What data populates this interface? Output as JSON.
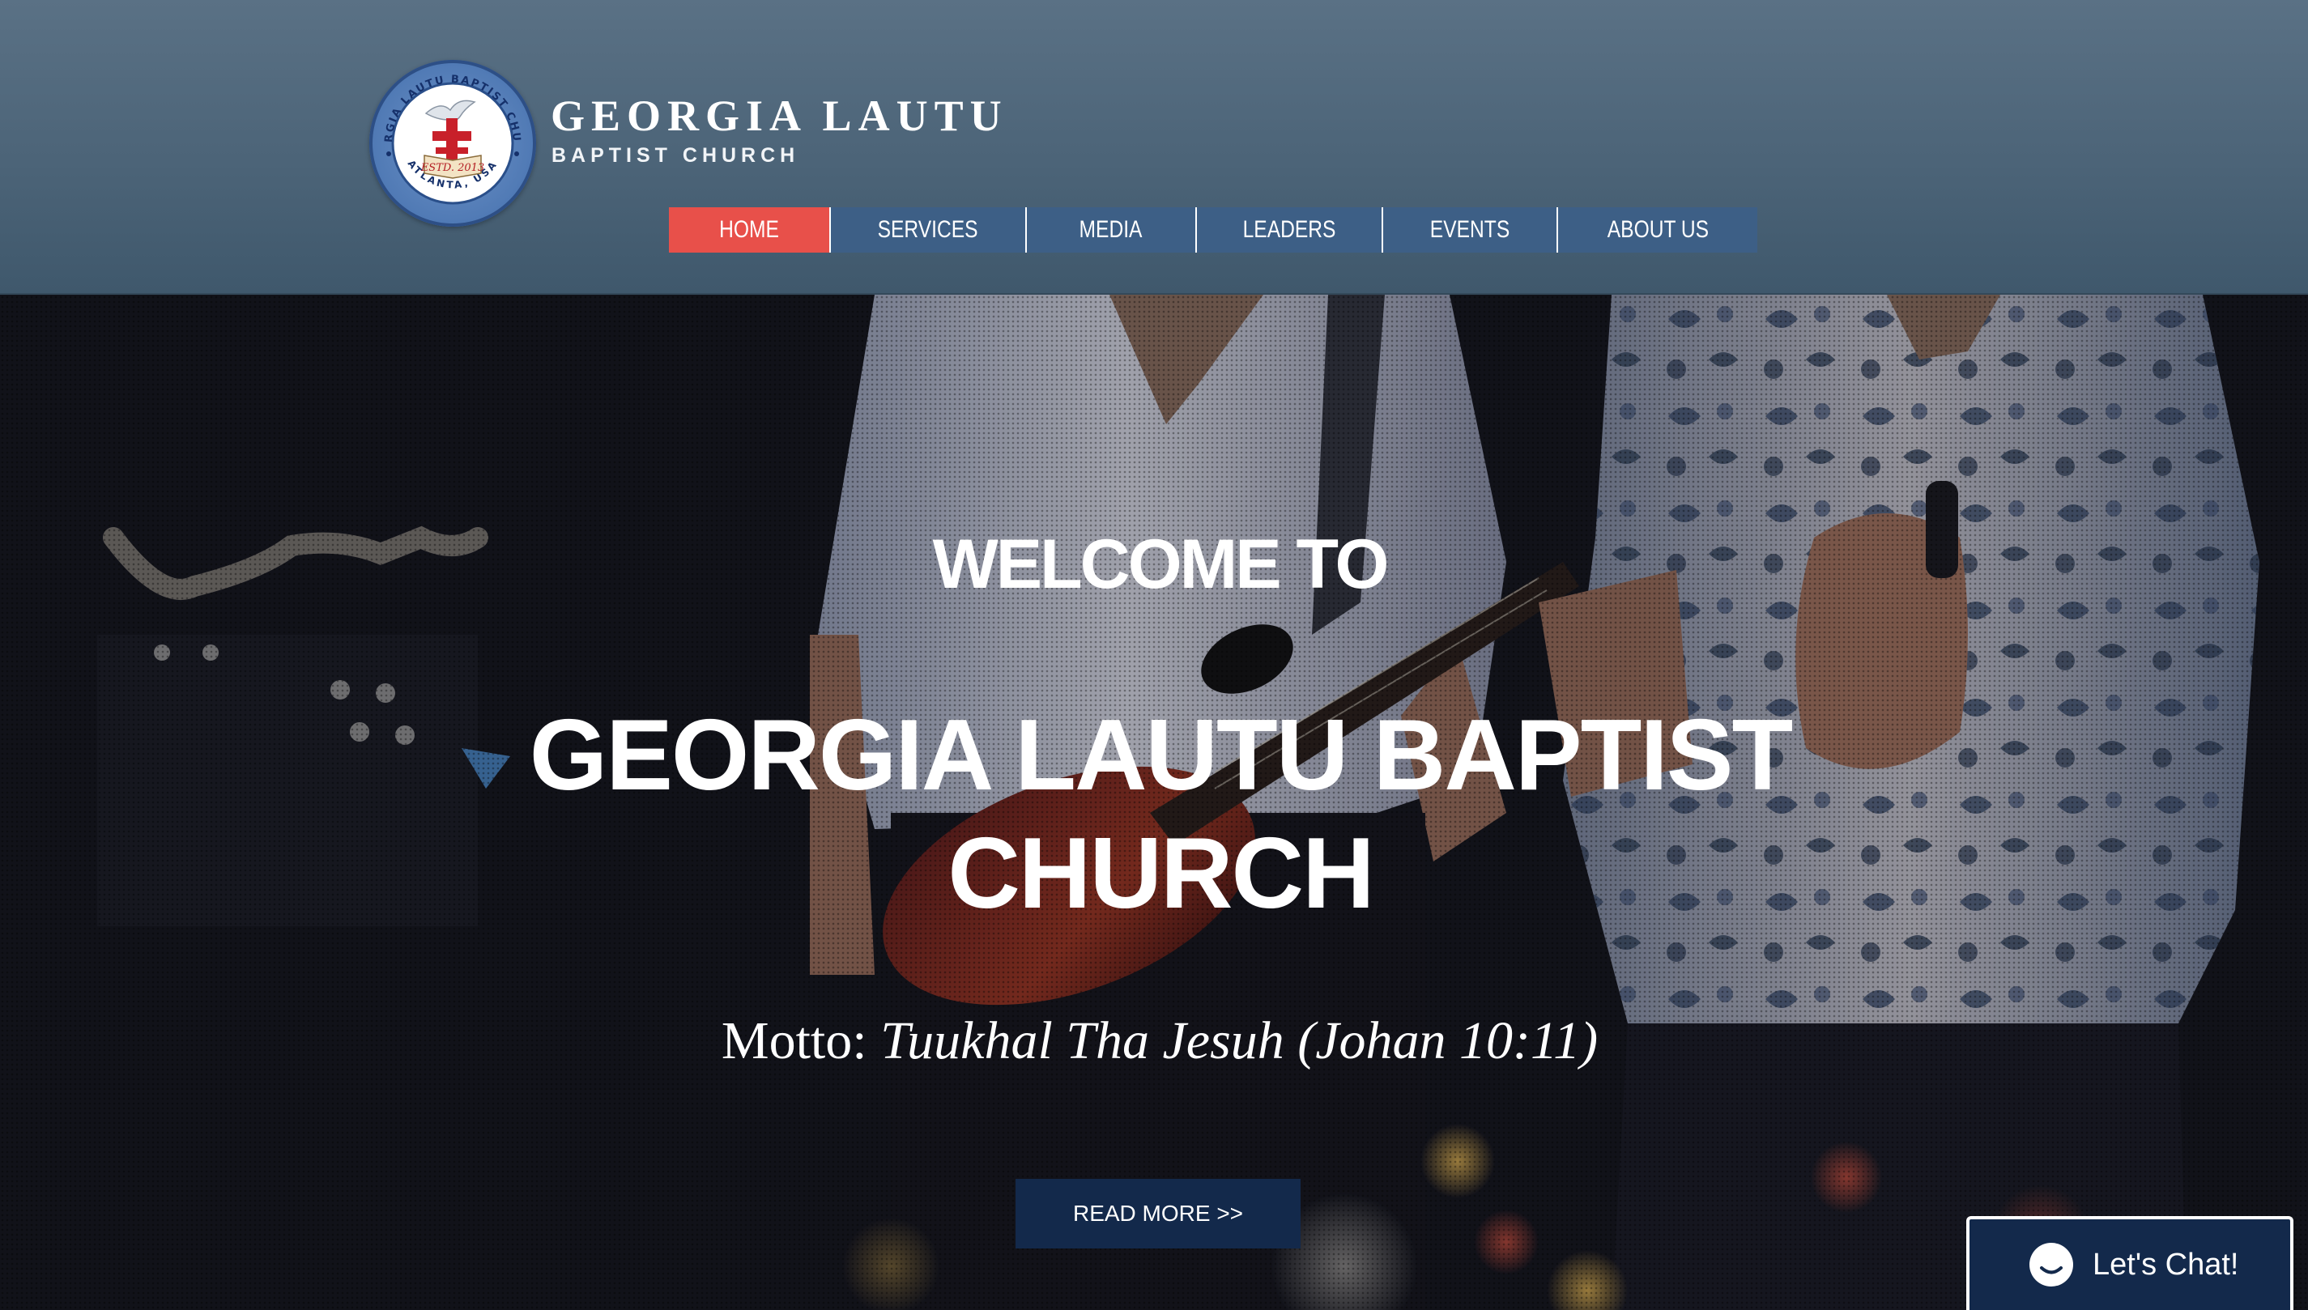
{
  "header": {
    "brand_name": "GEORGIA LAUTU",
    "brand_sub": "BAPTIST CHURCH",
    "logo_icon": "church-seal-logo",
    "logo_text": {
      "ring": "GEORGIA LAUTU BAPTIST CHURCH",
      "ring_bottom": "ATLANTA, USA",
      "established": "ESTD. 2013"
    }
  },
  "nav": {
    "items": [
      {
        "label": "HOME",
        "active": true
      },
      {
        "label": "SERVICES",
        "active": false
      },
      {
        "label": "MEDIA",
        "active": false
      },
      {
        "label": "LEADERS",
        "active": false
      },
      {
        "label": "EVENTS",
        "active": false
      },
      {
        "label": "ABOUT US",
        "active": false
      }
    ]
  },
  "hero": {
    "welcome": "WELCOME TO",
    "title": "GEORGIA LAUTU BAPTIST CHURCH",
    "motto_prefix": "Motto: ",
    "motto_verse": "Tuukhal Tha Jesuh (Johan 10:11)",
    "read_more": "READ MORE >>"
  },
  "chat": {
    "label": "Let's Chat!",
    "icon": "smiley-chat-icon"
  },
  "colors": {
    "header_bg": "#4f6679",
    "nav_bg": "#3d5f86",
    "nav_active": "#e8504a",
    "button_bg": "#13294b",
    "text": "#ffffff"
  }
}
